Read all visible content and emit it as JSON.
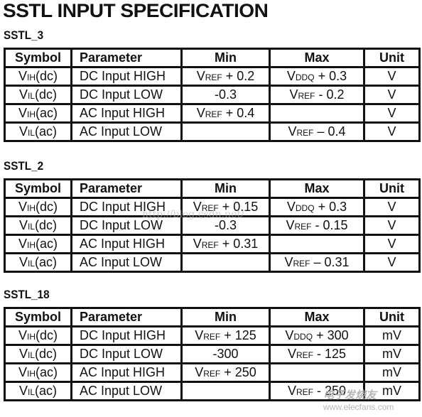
{
  "title": "SSTL INPUT SPECIFICATION",
  "headers": [
    "Symbol",
    "Parameter",
    "Min",
    "Max",
    "Unit"
  ],
  "tables": [
    {
      "name": "SSTL_3",
      "rows": [
        {
          "sym": "V",
          "sub": "IH",
          "suffix": "(dc)",
          "param": "DC Input HIGH",
          "min_pre": "V",
          "min_sub": "REF",
          "min_post": " + 0.2",
          "max_pre": "V",
          "max_sub": "DDQ",
          "max_post": " + 0.3",
          "unit": "V"
        },
        {
          "sym": "V",
          "sub": "IL",
          "suffix": "(dc)",
          "param": "DC Input LOW",
          "min_pre": "",
          "min_sub": "",
          "min_post": "-0.3",
          "max_pre": "V",
          "max_sub": "REF",
          "max_post": " - 0.2",
          "unit": "V"
        },
        {
          "sym": "V",
          "sub": "IH",
          "suffix": "(ac)",
          "param": "AC Input HIGH",
          "min_pre": "V",
          "min_sub": "REF",
          "min_post": " + 0.4",
          "max_pre": "",
          "max_sub": "",
          "max_post": "",
          "unit": "V"
        },
        {
          "sym": "V",
          "sub": "IL",
          "suffix": "(ac)",
          "param": "AC Input LOW",
          "min_pre": "",
          "min_sub": "",
          "min_post": "",
          "max_pre": "V",
          "max_sub": "REF",
          "max_post": " – 0.4",
          "unit": "V"
        }
      ]
    },
    {
      "name": "SSTL_2",
      "rows": [
        {
          "sym": "V",
          "sub": "IH",
          "suffix": "(dc)",
          "param": "DC Input HIGH",
          "min_pre": "V",
          "min_sub": "REF",
          "min_post": " + 0.15",
          "max_pre": "V",
          "max_sub": "DDQ",
          "max_post": " + 0.3",
          "unit": "V"
        },
        {
          "sym": "V",
          "sub": "IL",
          "suffix": "(dc)",
          "param": "DC Input LOW",
          "min_pre": "",
          "min_sub": "",
          "min_post": "-0.3",
          "max_pre": "V",
          "max_sub": "REF",
          "max_post": " - 0.15",
          "unit": "V"
        },
        {
          "sym": "V",
          "sub": "IH",
          "suffix": "(ac)",
          "param": "AC Input HIGH",
          "min_pre": "V",
          "min_sub": "REF",
          "min_post": " + 0.31",
          "max_pre": "",
          "max_sub": "",
          "max_post": "",
          "unit": "V"
        },
        {
          "sym": "V",
          "sub": "IL",
          "suffix": "(ac)",
          "param": "AC Input LOW",
          "min_pre": "",
          "min_sub": "",
          "min_post": "",
          "max_pre": "V",
          "max_sub": "REF",
          "max_post": " – 0.31",
          "unit": "V"
        }
      ]
    },
    {
      "name": "SSTL_18",
      "rows": [
        {
          "sym": "V",
          "sub": "IH",
          "suffix": "(dc)",
          "param": "DC Input HIGH",
          "min_pre": "V",
          "min_sub": "REF",
          "min_post": " + 125",
          "max_pre": "V",
          "max_sub": "DDQ",
          "max_post": " + 300",
          "unit": "mV"
        },
        {
          "sym": "V",
          "sub": "IL",
          "suffix": "(dc)",
          "param": "DC Input LOW",
          "min_pre": "",
          "min_sub": "",
          "min_post": "-300",
          "max_pre": "V",
          "max_sub": "REF",
          "max_post": " - 125",
          "unit": "mV"
        },
        {
          "sym": "V",
          "sub": "IH",
          "suffix": "(ac)",
          "param": "AC Input HIGH",
          "min_pre": "V",
          "min_sub": "REF",
          "min_post": " + 250",
          "max_pre": "",
          "max_sub": "",
          "max_post": "",
          "unit": "mV"
        },
        {
          "sym": "V",
          "sub": "IL",
          "suffix": "(ac)",
          "param": "AC Input LOW",
          "min_pre": "",
          "min_sub": "",
          "min_post": "",
          "max_pre": "V",
          "max_sub": "REF",
          "max_post": " - 250",
          "unit": "mV"
        }
      ]
    }
  ],
  "watermarks": {
    "url": "http://blog.csdn.net/",
    "site_cn": "电子发烧友",
    "site_url": "www.elecfans.com"
  }
}
